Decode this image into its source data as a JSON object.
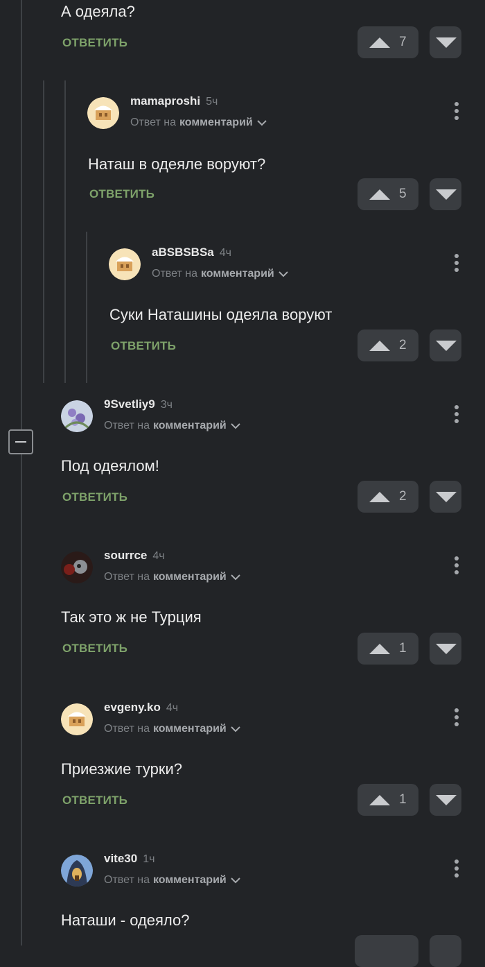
{
  "colors": {
    "background": "#222427",
    "reply_green": "#7ea26a",
    "button_bg": "#3a3d41",
    "muted_text": "#7d8185"
  },
  "top_comment": {
    "text": "А одеяла?",
    "reply_label": "ОТВЕТИТЬ",
    "rating": "7"
  },
  "comments": [
    {
      "username": "mamaproshi",
      "time": "5ч",
      "reply_prefix": "Ответ на",
      "reply_target": "комментарий",
      "avatar": "default-pikabu-avatar",
      "text": "Наташ в одеяле воруют?",
      "reply_label": "ОТВЕТИТЬ",
      "rating": "5"
    },
    {
      "username": "aBSBSBSa",
      "time": "4ч",
      "reply_prefix": "Ответ на",
      "reply_target": "комментарий",
      "avatar": "default-pikabu-avatar",
      "text": "Суки Наташины одеяла воруют",
      "reply_label": "ОТВЕТИТЬ",
      "rating": "2"
    },
    {
      "username": "9Svetliy9",
      "time": "3ч",
      "reply_prefix": "Ответ на",
      "reply_target": "комментарий",
      "avatar": "flowers-photo-avatar",
      "text": "Под одеялом!",
      "reply_label": "ОТВЕТИТЬ",
      "rating": "2"
    },
    {
      "username": "sourrce",
      "time": "4ч",
      "reply_prefix": "Ответ на",
      "reply_target": "комментарий",
      "avatar": "dark-photo-avatar",
      "text": "Так это ж не Турция",
      "reply_label": "ОТВЕТИТЬ",
      "rating": "1"
    },
    {
      "username": "evgeny.ko",
      "time": "4ч",
      "reply_prefix": "Ответ на",
      "reply_target": "комментарий",
      "avatar": "default-pikabu-avatar",
      "text": "Приезжие турки?",
      "reply_label": "ОТВЕТИТЬ",
      "rating": "1"
    },
    {
      "username": "vite30",
      "time": "1ч",
      "reply_prefix": "Ответ на",
      "reply_target": "комментарий",
      "avatar": "hooded-figure-avatar",
      "text": "Наташи - одеяло?",
      "reply_label": "",
      "rating": ""
    }
  ]
}
